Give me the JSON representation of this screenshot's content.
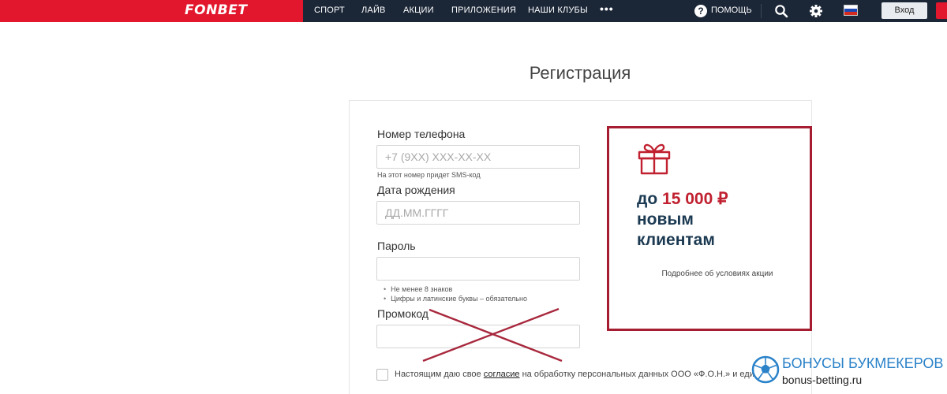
{
  "header": {
    "logo": "FONBET",
    "nav": [
      "СПОРТ",
      "ЛАЙВ",
      "АКЦИИ",
      "ПРИЛОЖЕНИЯ",
      "НАШИ КЛУБЫ"
    ],
    "more": "•••",
    "help_label": "ПОМОЩЬ",
    "login_label": "Вход",
    "icons": [
      "help-icon",
      "search-icon",
      "gear-icon",
      "russia-flag-icon"
    ]
  },
  "page": {
    "title": "Регистрация"
  },
  "form": {
    "phone": {
      "label": "Номер телефона",
      "placeholder": "+7 (9XX) XXX-XX-XX",
      "hint": "На этот номер придет SMS-код"
    },
    "birthdate": {
      "label": "Дата рождения",
      "placeholder": "ДД.ММ.ГГГГ"
    },
    "password": {
      "label": "Пароль",
      "placeholder": "",
      "hints": [
        "Не менее 8 знаков",
        "Цифры и латинские буквы – обязательно"
      ]
    },
    "promo": {
      "label": "Промокод",
      "placeholder": ""
    },
    "consent": {
      "prefix": "Настоящим даю свое",
      "link": "согласие",
      "suffix": "на обработку персональных данных ООО «Ф.О.Н.» и едином"
    }
  },
  "promo_block": {
    "prefix": "до",
    "amount": "15 000 ₽",
    "line2": "новым",
    "line3": "клиентам",
    "link": "Подробнее об условиях акции"
  },
  "watermark": {
    "title": "БОНУСЫ БУКМЕКЕРОВ",
    "url": "bonus-betting.ru"
  },
  "colors": {
    "header_bg": "#1b2637",
    "brand_red": "#e2172e",
    "promo_border": "#a61c30",
    "promo_text": "#1b3a52",
    "cross": "#a8283d"
  }
}
